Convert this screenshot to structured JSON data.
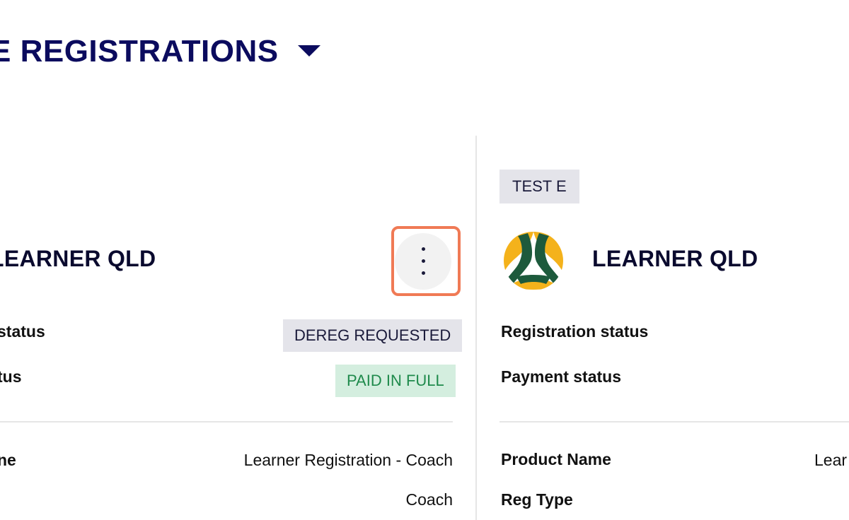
{
  "header": {
    "title": "E REGISTRATIONS"
  },
  "left_card": {
    "title": "LEARNER QLD",
    "rows": [
      {
        "label": "status",
        "badge": "DEREG REQUESTED"
      },
      {
        "label": "tus",
        "badge": "PAID IN FULL"
      }
    ],
    "details": [
      {
        "label": "ne",
        "value": "Learner Registration - Coach"
      },
      {
        "label": "",
        "value": "Coach"
      }
    ]
  },
  "right_card": {
    "tag": "TEST E",
    "title": "LEARNER QLD",
    "rows": [
      {
        "label": "Registration status"
      },
      {
        "label": "Payment status"
      }
    ],
    "details": [
      {
        "label": "Product Name",
        "value": "Lear"
      },
      {
        "label": "Reg Type",
        "value": ""
      }
    ]
  },
  "colors": {
    "title": "#0b0b5e",
    "highlight": "#f07a55",
    "badge_grey": "#e4e4ea",
    "badge_green_bg": "#d4eedf",
    "badge_green_text": "#1f8a4c",
    "logo_green": "#1d5a3c",
    "logo_gold": "#f4b21b"
  },
  "icons": {
    "title_dropdown": "caret-down-icon",
    "menu": "kebab-menu-icon",
    "logo": "football-australia-logo"
  }
}
